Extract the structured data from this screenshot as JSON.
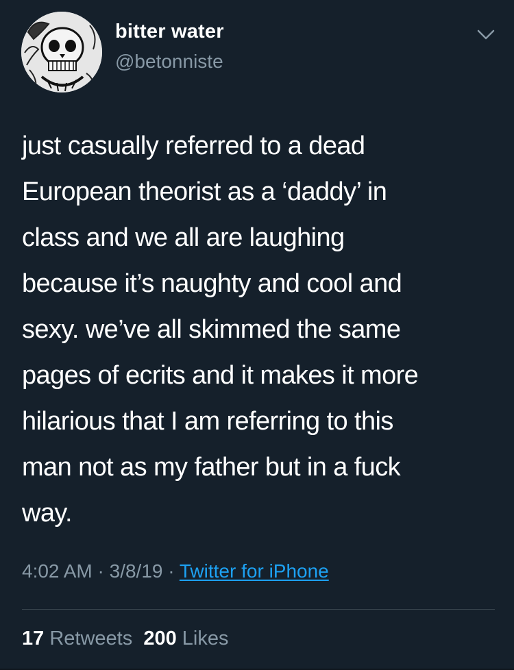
{
  "author": {
    "display_name": "bitter water",
    "handle": "@betonniste"
  },
  "tweet": {
    "text": "just casually referred to a dead\nEuropean theorist as a ‘daddy’ in\nclass and we all are laughing\nbecause it’s naughty and cool and\nsexy. we’ve all skimmed the same\npages of ecrits and it makes it more\nhilarious that I am referring to this\nman not as my father but in a fuck\nway."
  },
  "meta": {
    "time": "4:02 AM",
    "separator": " · ",
    "date": "3/8/19",
    "source": "Twitter for iPhone"
  },
  "stats": {
    "retweets_count": "17",
    "retweets_label": "Retweets",
    "likes_count": "200",
    "likes_label": "Likes"
  },
  "icons": {
    "menu": "chevron-down-icon",
    "avatar": "skull-illustration-avatar"
  },
  "colors": {
    "background": "#15202b",
    "text": "#ffffff",
    "secondary_text": "#8899a6",
    "link": "#1da1f2",
    "divider": "#38444d"
  }
}
